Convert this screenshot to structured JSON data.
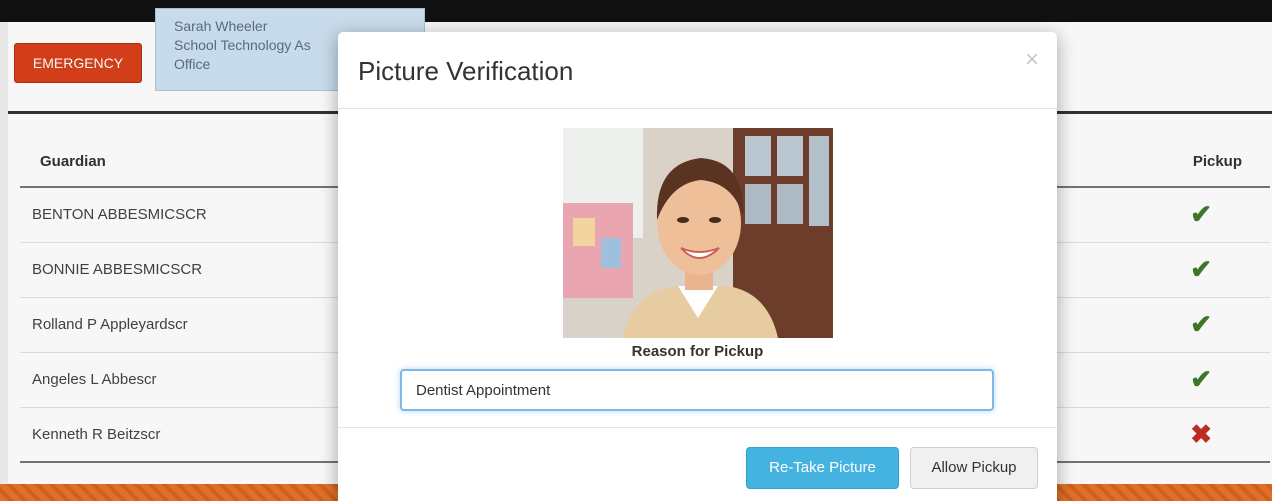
{
  "header": {
    "emergency_label": "EMERGENCY",
    "user": {
      "name": "Sarah Wheeler",
      "title": "School Technology As",
      "location": "Office"
    }
  },
  "table": {
    "columns": {
      "guardian": "Guardian",
      "pickup": "Pickup"
    },
    "rows": [
      {
        "name": "BENTON ABBESMICSCR",
        "pickup": "✔",
        "status": "allowed"
      },
      {
        "name": "BONNIE ABBESMICSCR",
        "pickup": "✔",
        "status": "allowed"
      },
      {
        "name": "Rolland P Appleyardscr",
        "pickup": "✔",
        "status": "allowed"
      },
      {
        "name": "Angeles L Abbescr",
        "pickup": "✔",
        "status": "allowed"
      },
      {
        "name": "Kenneth R Beitzscr",
        "pickup": "✖",
        "status": "denied"
      }
    ]
  },
  "modal": {
    "title": "Picture Verification",
    "close_icon": "×",
    "reason_label": "Reason for Pickup",
    "reason_value": "Dentist Appointment",
    "retake_label": "Re-Take Picture",
    "allow_label": "Allow Pickup"
  },
  "colors": {
    "emergency": "#d9401a",
    "allowed": "#3d7a2b",
    "denied": "#c03024",
    "primary_button": "#45b3e0"
  }
}
